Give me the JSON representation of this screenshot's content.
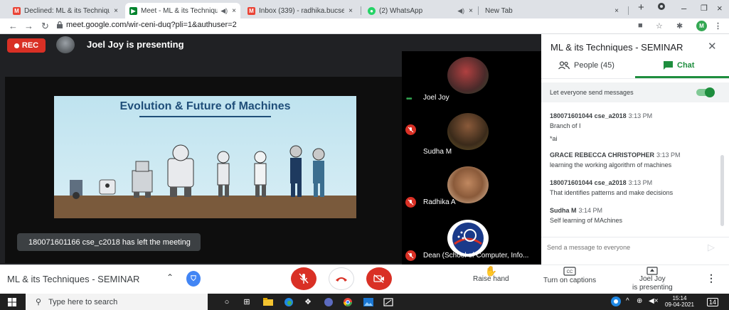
{
  "browser": {
    "tabs": [
      {
        "label": "Declined: ML & its Technique",
        "icon": "gmail-icon",
        "color": "#ea4335",
        "letter": "M"
      },
      {
        "label": "Meet - ML & its Techniqu",
        "icon": "meet-icon",
        "color": "#00832d",
        "letter": "▶"
      },
      {
        "label": "Inbox (339) - radhika.bucse@",
        "icon": "gmail-icon",
        "color": "#ea4335",
        "letter": "M"
      },
      {
        "label": "(2) WhatsApp",
        "icon": "whatsapp-icon",
        "color": "#25d366",
        "letter": "●"
      },
      {
        "label": "New Tab",
        "icon": "newtab-icon",
        "color": "#dee1e6",
        "letter": ""
      }
    ],
    "tab_close": "×",
    "new_tab": "+",
    "url": "meet.google.com/wir-ceni-duq?pli=1&authuser=2",
    "profile_letter": "M"
  },
  "meet": {
    "rec_label": "REC",
    "presenting_label": "Joel Joy is presenting",
    "slide_title": "Evolution & Future of Machines",
    "toast": "180071601166 cse_c2018 has left the meeting",
    "participants": [
      {
        "name": "Joel Joy",
        "muted": false
      },
      {
        "name": "Sudha M",
        "muted": true
      },
      {
        "name": "Radhika A",
        "muted": true
      },
      {
        "name": "Dean (School of Computer, Info...",
        "muted": true
      }
    ]
  },
  "panel": {
    "title": "ML & its Techniques - SEMINAR",
    "tab_people": "People (45)",
    "tab_chat": "Chat",
    "let_everyone": "Let everyone send messages",
    "let_everyone_on": true,
    "messages": [
      {
        "sender": "180071601044 cse_a2018",
        "time": "3:13 PM",
        "lines": [
          "Branch of I",
          "*ai"
        ]
      },
      {
        "sender": "GRACE REBECCA CHRISTOPHER",
        "time": "3:13 PM",
        "lines": [
          "learning the working algorithm of machines"
        ]
      },
      {
        "sender": "180071601044 cse_a2018",
        "time": "3:13 PM",
        "lines": [
          "That identifies patterns and make decisions"
        ]
      },
      {
        "sender": "Sudha M",
        "time": "3:14 PM",
        "lines": [
          "Self learning of MAchines"
        ]
      }
    ],
    "send_placeholder": "Send a message to everyone"
  },
  "bottombar": {
    "meeting_title": "ML & its Techniques - SEMINAR",
    "raise_hand": "Raise hand",
    "captions": "Turn on captions",
    "presenting_line1": "Joel Joy",
    "presenting_line2": "is presenting"
  },
  "taskbar": {
    "search_placeholder": "Type here to search",
    "time": "15:14",
    "date": "09-04-2021",
    "notifications": "14"
  },
  "colors": {
    "accent_green": "#1e8e3e",
    "danger_red": "#d93025"
  }
}
